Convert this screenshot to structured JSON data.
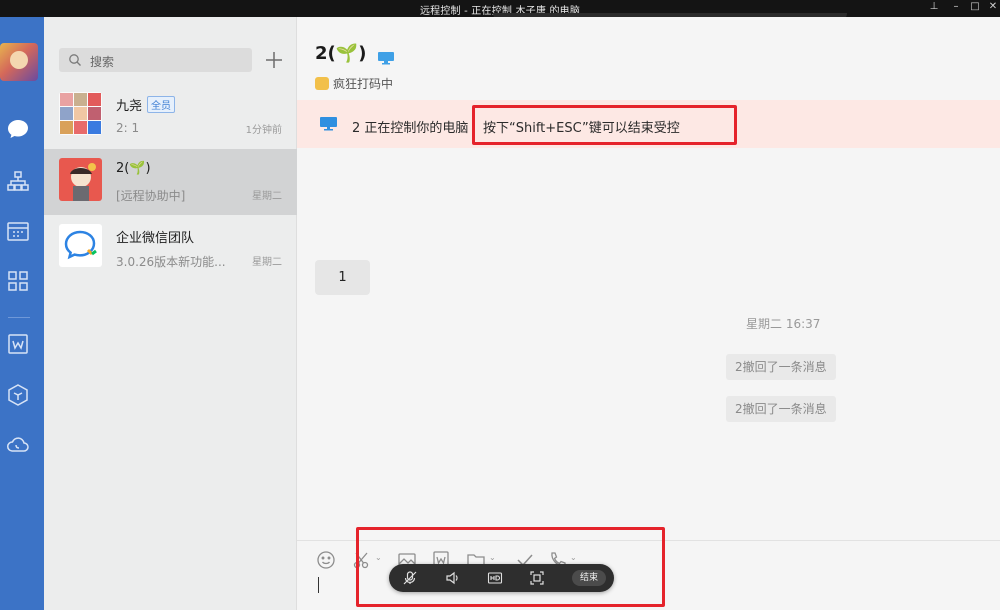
{
  "window": {
    "title": "远程控制 - 正在控制 木子唐 的电脑"
  },
  "search": {
    "placeholder": "搜索"
  },
  "conversations": [
    {
      "name": "九尧",
      "badge": "全员",
      "preview": "2: 1",
      "time": "1分钟前"
    },
    {
      "name": "2(🌱)",
      "preview": "[远程协助中]",
      "time": "星期二"
    },
    {
      "name": "企业微信团队",
      "preview": "3.0.26版本新功能...",
      "time": "星期二"
    }
  ],
  "chat": {
    "title_prefix": "2(",
    "title_emoji": "🌱",
    "title_suffix": ")",
    "status": "疯狂打码中",
    "banner_text": "2 正在控制你的电脑",
    "banner_hint": "按下“Shift+ESC”键可以结束受控",
    "messages": [
      {
        "text": "1"
      }
    ],
    "timestamp": "星期二 16:37",
    "recalls": [
      "2撤回了一条消息",
      "2撤回了一条消息"
    ]
  },
  "remote_bar": {
    "end_label": "结束"
  },
  "colors": {
    "accent_blue": "#3c73c6",
    "highlight_red": "#e5232b",
    "banner_bg": "#fde8e4"
  }
}
